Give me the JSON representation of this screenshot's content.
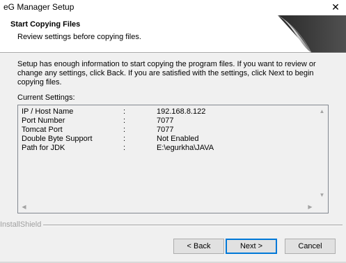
{
  "window": {
    "title": "eG Manager Setup",
    "close_glyph": "✕"
  },
  "header": {
    "title": "Start Copying Files",
    "subtitle": "Review settings before copying files."
  },
  "intro": {
    "text": "Setup has enough information to start copying the program files.  If you want to review or change any settings, click Back.  If you are satisfied with the settings, click Next to begin copying files."
  },
  "current_settings": {
    "label": "Current Settings:",
    "rows": [
      {
        "name": "IP / Host Name",
        "sep": ":",
        "value": "192.168.8.122"
      },
      {
        "name": "Port Number",
        "sep": ":",
        "value": "7077"
      },
      {
        "name": "Tomcat Port",
        "sep": ":",
        "value": "7077"
      },
      {
        "name": "Double Byte Support",
        "sep": ":",
        "value": "Not Enabled"
      },
      {
        "name": "Path for JDK",
        "sep": ":",
        "value": "E:\\egurkha\\JAVA"
      }
    ]
  },
  "footer": {
    "brand": "InstallShield"
  },
  "buttons": {
    "back": "< Back",
    "next": "Next >",
    "cancel": "Cancel"
  },
  "colors": {
    "background": "#f0f0f0",
    "header_background": "#ffffff",
    "default_button_border": "#0078d7"
  },
  "icons": {
    "header_graphic": "page-curl-icon",
    "close": "close-icon"
  }
}
